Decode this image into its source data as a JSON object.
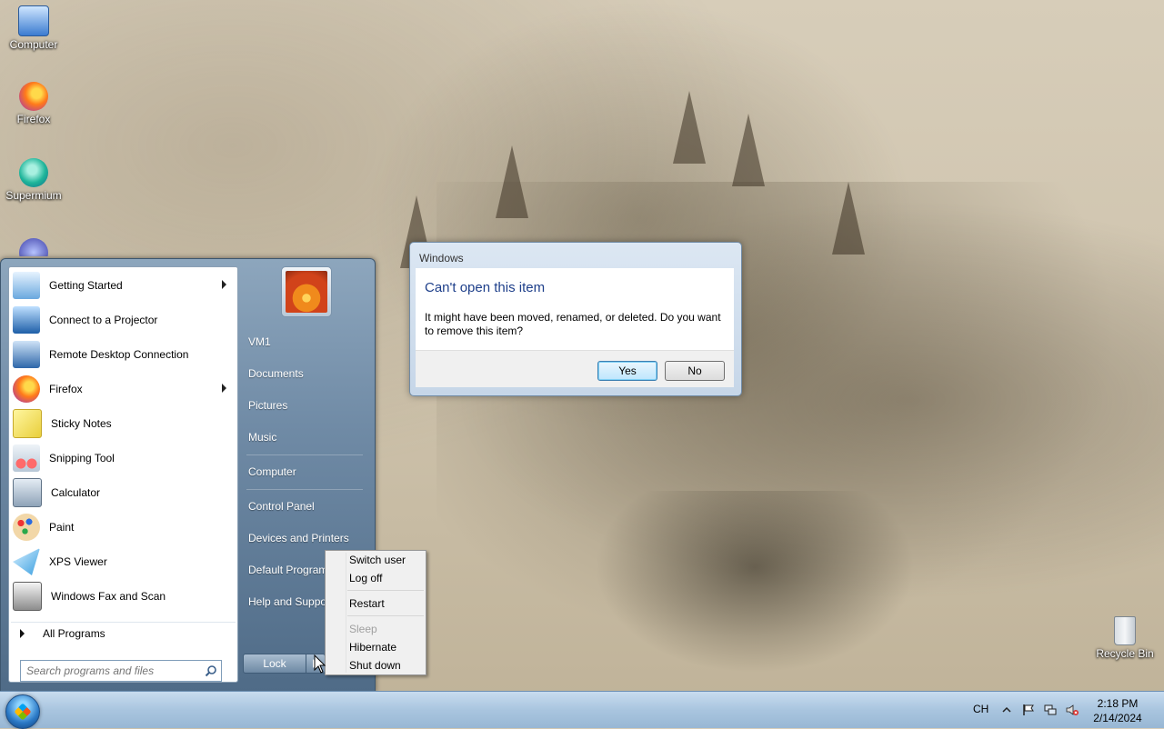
{
  "desktop": {
    "icons": [
      {
        "label": "Computer"
      },
      {
        "label": "Firefox"
      },
      {
        "label": "Supermium"
      },
      {
        "label": "Recycle Bin"
      }
    ]
  },
  "start_menu": {
    "programs": [
      {
        "label": "Getting Started",
        "has_submenu": true
      },
      {
        "label": "Connect to a Projector",
        "has_submenu": false
      },
      {
        "label": "Remote Desktop Connection",
        "has_submenu": false
      },
      {
        "label": "Firefox",
        "has_submenu": true
      },
      {
        "label": "Sticky Notes",
        "has_submenu": false
      },
      {
        "label": "Snipping Tool",
        "has_submenu": false
      },
      {
        "label": "Calculator",
        "has_submenu": false
      },
      {
        "label": "Paint",
        "has_submenu": false
      },
      {
        "label": "XPS Viewer",
        "has_submenu": false
      },
      {
        "label": "Windows Fax and Scan",
        "has_submenu": false
      }
    ],
    "all_programs": "All Programs",
    "search_placeholder": "Search programs and files",
    "right_links": [
      {
        "label": "VM1"
      },
      {
        "label": "Documents"
      },
      {
        "label": "Pictures"
      },
      {
        "label": "Music"
      },
      {
        "label": "Computer"
      },
      {
        "label": "Control Panel"
      },
      {
        "label": "Devices and Printers"
      },
      {
        "label": "Default Programs"
      },
      {
        "label": "Help and Support"
      }
    ],
    "lock_label": "Lock"
  },
  "power_menu": {
    "items": [
      {
        "label": "Switch user",
        "enabled": true
      },
      {
        "label": "Log off",
        "enabled": true
      },
      {
        "label": "Restart",
        "enabled": true
      },
      {
        "label": "Sleep",
        "enabled": false
      },
      {
        "label": "Hibernate",
        "enabled": true
      },
      {
        "label": "Shut down",
        "enabled": true
      }
    ]
  },
  "dialog": {
    "title": "Windows",
    "heading": "Can't open this item",
    "message": "It might have been moved, renamed, or deleted. Do you want to remove this item?",
    "yes_label": "Yes",
    "no_label": "No"
  },
  "taskbar": {
    "language": "CH",
    "time": "2:18 PM",
    "date": "2/14/2024"
  },
  "colors": {
    "dialog_heading": "#1e3f8a",
    "start_menu_panel": "#6f8aa5",
    "taskbar": "#a9c5df"
  }
}
